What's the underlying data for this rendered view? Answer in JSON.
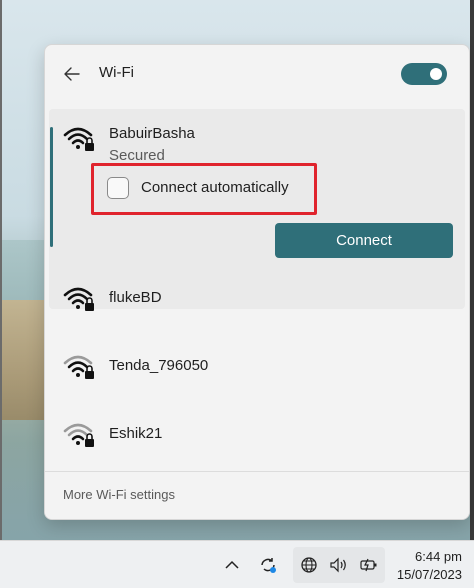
{
  "flyout": {
    "title": "Wi-Fi",
    "wifi_enabled": true,
    "accent_color": "#2f6f79",
    "highlight_color": "#e0242d",
    "expanded_network": {
      "name": "BabuirBasha",
      "status": "Secured",
      "connect_automatically_label": "Connect automatically",
      "connect_automatically_checked": false,
      "connect_label": "Connect"
    },
    "networks": [
      {
        "name": "flukeBD",
        "icon": "wifi-secured-icon"
      },
      {
        "name": "Tenda_796050",
        "icon": "wifi-secured-icon"
      },
      {
        "name": "Eshik21",
        "icon": "wifi-secured-icon"
      }
    ],
    "footer_link": "More Wi-Fi settings"
  },
  "taskbar": {
    "time": "6:44 pm",
    "date": "15/07/2023",
    "icons": [
      "chevron-up-icon",
      "sync-icon",
      "globe-icon",
      "volume-icon",
      "battery-icon"
    ]
  }
}
